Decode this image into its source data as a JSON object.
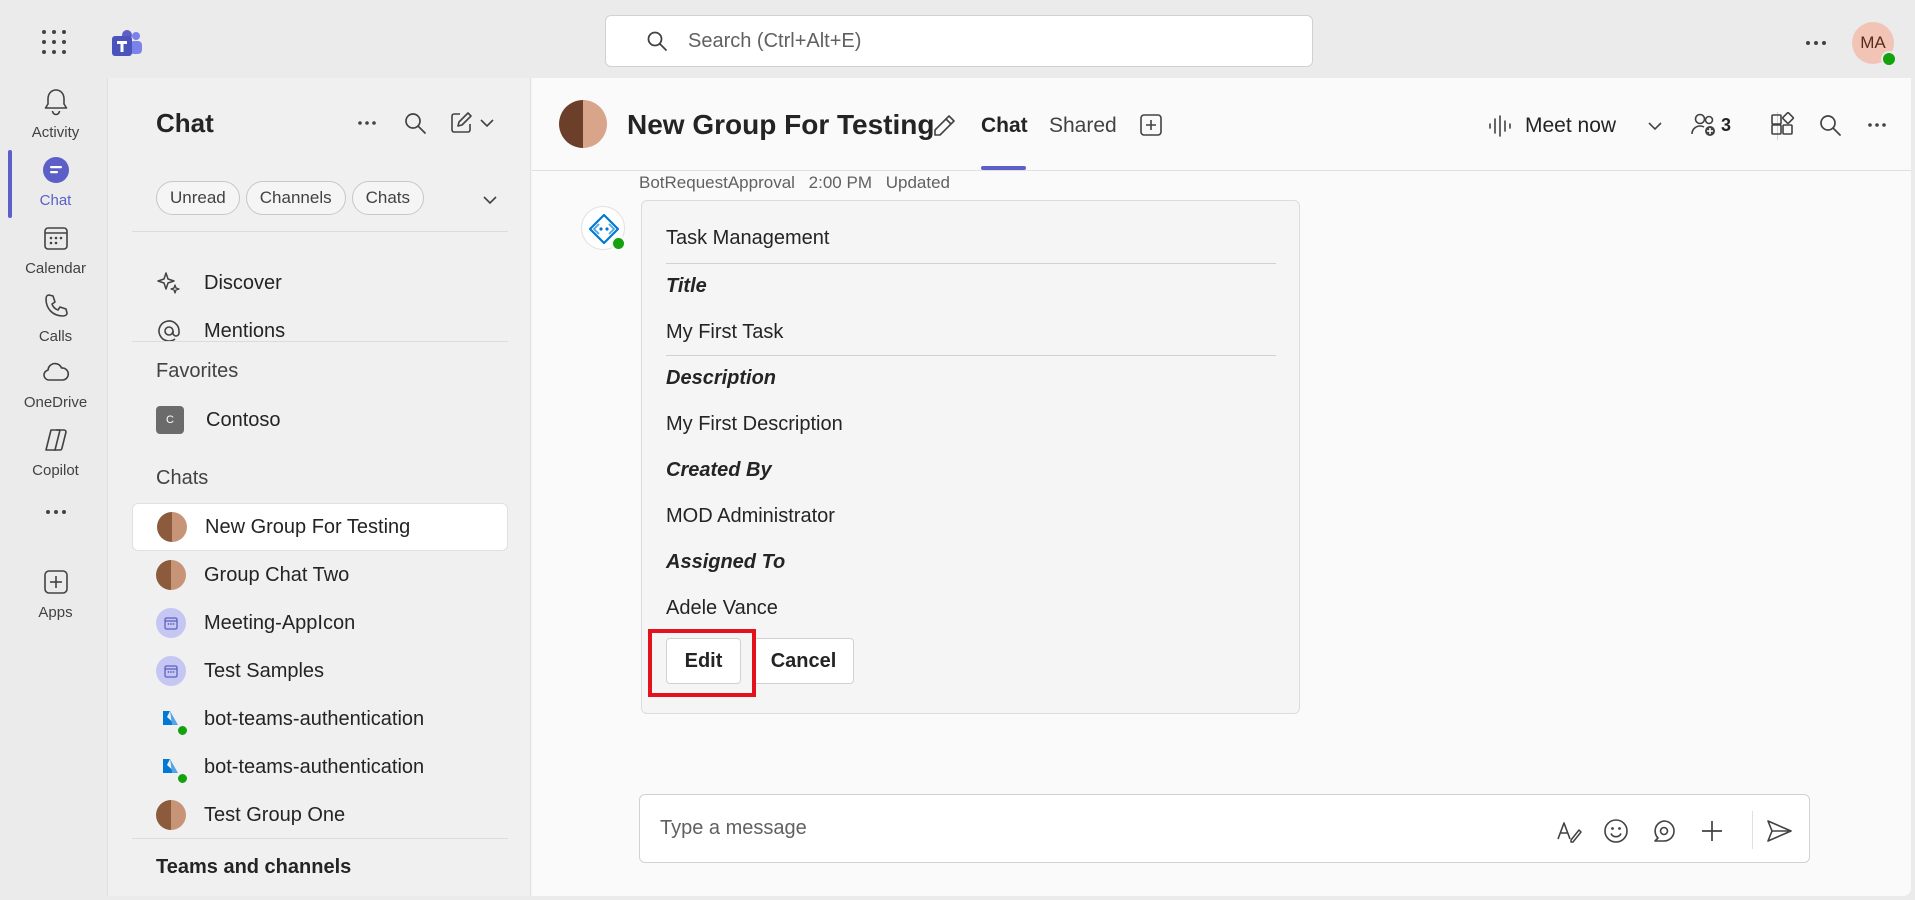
{
  "app": {
    "search_placeholder": "Search (Ctrl+Alt+E)",
    "user_initials": "MA",
    "accent_color": "#5b5fc7"
  },
  "rail": {
    "items": [
      {
        "label": "Activity",
        "icon": "bell-icon"
      },
      {
        "label": "Chat",
        "icon": "chat-icon"
      },
      {
        "label": "Calendar",
        "icon": "calendar-icon"
      },
      {
        "label": "Calls",
        "icon": "phone-icon"
      },
      {
        "label": "OneDrive",
        "icon": "cloud-icon"
      },
      {
        "label": "Copilot",
        "icon": "copilot-icon"
      },
      {
        "label": "Apps",
        "icon": "add-app-icon"
      }
    ],
    "active": "Chat"
  },
  "leftpane": {
    "title": "Chat",
    "filters": [
      "Unread",
      "Channels",
      "Chats"
    ],
    "nav": [
      {
        "label": "Discover",
        "icon": "sparkle-icon"
      },
      {
        "label": "Mentions",
        "icon": "at-icon"
      }
    ],
    "favorites_label": "Favorites",
    "favorites": [
      {
        "label": "Contoso",
        "initial": "C"
      }
    ],
    "chats_label": "Chats",
    "chats": [
      {
        "label": "New Group For Testing",
        "avatar": "photo",
        "selected": true
      },
      {
        "label": "Group Chat Two",
        "avatar": "photo"
      },
      {
        "label": "Meeting-AppIcon",
        "avatar": "calendar"
      },
      {
        "label": "Test Samples",
        "avatar": "calendar"
      },
      {
        "label": "bot-teams-authentication",
        "avatar": "bot"
      },
      {
        "label": "bot-teams-authentication",
        "avatar": "bot"
      },
      {
        "label": "Test Group One",
        "avatar": "photo"
      }
    ],
    "teams_label": "Teams and channels"
  },
  "header": {
    "title": "New Group For Testing",
    "tabs": [
      "Chat",
      "Shared"
    ],
    "active_tab": "Chat",
    "meet_label": "Meet now",
    "participants_count": "3"
  },
  "message": {
    "sender": "BotRequestApproval",
    "time": "2:00 PM",
    "status": "Updated",
    "card": {
      "heading": "Task Management",
      "fields": [
        {
          "label": "Title",
          "value": "My First Task"
        },
        {
          "label": "Description",
          "value": "My First Description"
        },
        {
          "label": "Created By",
          "value": "MOD Administrator"
        },
        {
          "label": "Assigned To",
          "value": "Adele Vance"
        }
      ],
      "edit_label": "Edit",
      "cancel_label": "Cancel",
      "highlight_color": "#e3131d"
    }
  },
  "compose": {
    "placeholder": "Type a message"
  }
}
